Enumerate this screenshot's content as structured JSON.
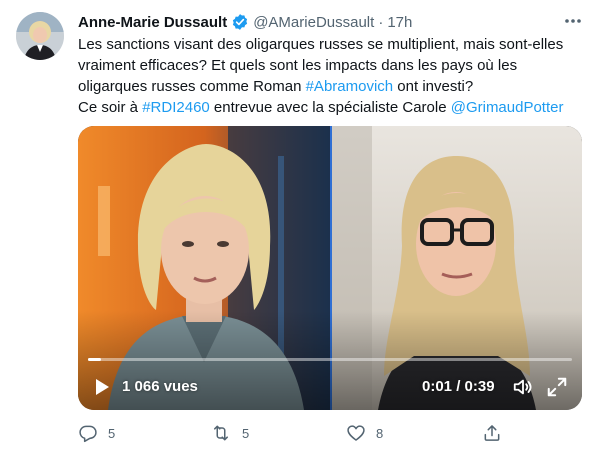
{
  "tweet": {
    "author_name": "Anne-Marie Dussault",
    "handle": "@AMarieDussault",
    "separator": "·",
    "time": "17h",
    "text": {
      "line1": "Les sanctions visant des oligarques russes se multiplient, mais sont-elles",
      "line2": "vraiment efficaces? Et quels sont les impacts dans les pays où les",
      "line3_a": "oligarques russes comme Roman ",
      "line3_link": "#Abramovich",
      "line3_b": " ont investi?",
      "line4_a": "Ce soir à ",
      "line4_link1": "#RDI2460",
      "line4_b": " entrevue avec la spécialiste Carole ",
      "line4_link2": "@GrimaudPotter"
    }
  },
  "video": {
    "views": "1 066 vues",
    "timecode": "0:01 / 0:39",
    "progress": 0.026
  },
  "actions": {
    "reply_count": "5",
    "retweet_count": "5",
    "like_count": "8"
  },
  "icons": {
    "verified": "verified-badge-icon",
    "more": "more-horizontal-icon",
    "play": "play-icon",
    "volume": "volume-icon",
    "fullscreen": "fullscreen-icon",
    "reply": "reply-icon",
    "retweet": "retweet-icon",
    "like": "heart-icon",
    "share": "share-icon"
  },
  "colors": {
    "link": "#1d9bf0",
    "verified": "#1d9bf0",
    "secondary_text": "#536471"
  }
}
